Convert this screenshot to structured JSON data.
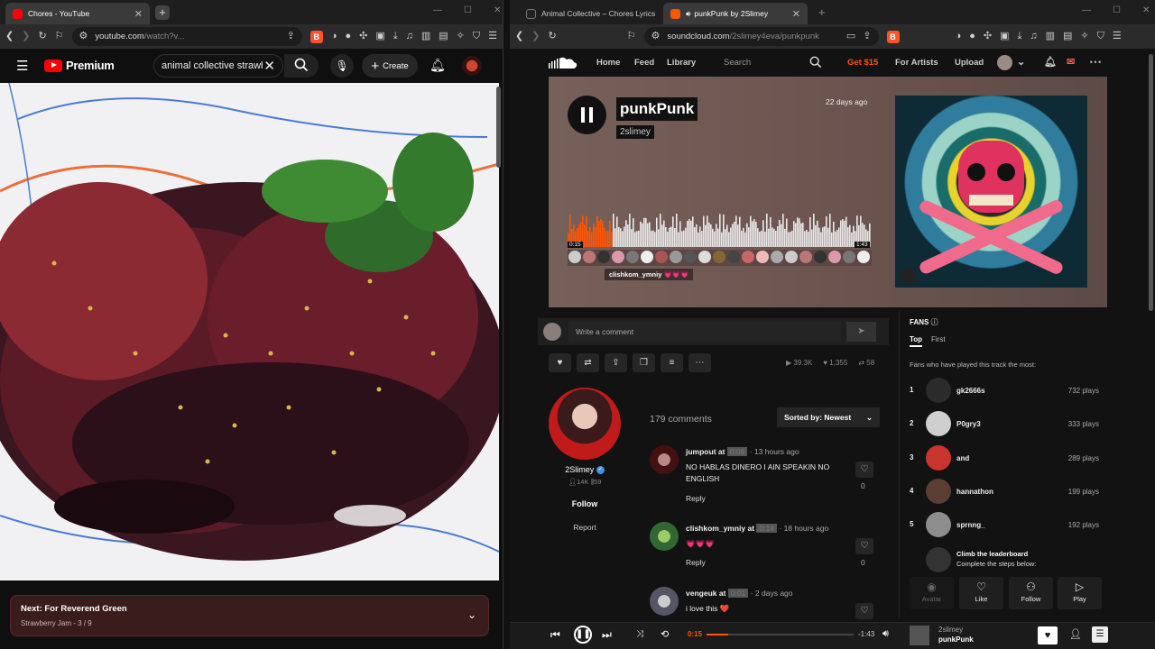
{
  "left_window": {
    "tab": {
      "title": "Chores - YouTube"
    },
    "url": {
      "domain": "youtube.com",
      "path": "/watch?v..."
    },
    "youtube": {
      "logo_text": "Premium",
      "search_value": "animal collective strawb",
      "create_label": "Create",
      "next": {
        "label": "Next: For Reverend Green",
        "playlist": "Strawberry Jam",
        "position": "3 / 9"
      }
    }
  },
  "right_window": {
    "tabs": [
      {
        "title": "Animal Collective – Chores Lyrics | Ge"
      },
      {
        "title": "punkPunk by 2Slimey",
        "active": true
      }
    ],
    "url": {
      "domain": "soundcloud.com",
      "path": "/2slimey4eva/punkpunk"
    },
    "nav": {
      "home": "Home",
      "feed": "Feed",
      "library": "Library",
      "search_placeholder": "Search",
      "get": "Get $15",
      "for_artists": "For Artists",
      "upload": "Upload"
    },
    "track": {
      "title": "punkPunk",
      "artist": "2slimey",
      "age": "22 days ago",
      "time_elapsed": "0:15",
      "time_total": "1:43",
      "progress": 0.146,
      "waveform_comment_user": "clishkom_ymniy",
      "waveform_comment_text": "💗💗💗"
    },
    "comment_input": {
      "placeholder": "Write a comment"
    },
    "stats": {
      "plays": "39.3K",
      "likes": "1,355",
      "reposts": "58"
    },
    "artist": {
      "name": "2Slimey",
      "followers": "14K",
      "tracks": "59",
      "follow": "Follow",
      "report": "Report"
    },
    "comments_header": {
      "count": "179 comments",
      "sort": "Sorted by: Newest"
    },
    "comments": [
      {
        "user": "jumpout",
        "at": "at",
        "timestamp": "0:08",
        "age": "· 13 hours ago",
        "text": "NO HABLAS DINERO I AIN SPEAKIN NO ENGLISH",
        "reply": "Reply",
        "likes": "0"
      },
      {
        "user": "clishkom_ymniy",
        "at": "at",
        "timestamp": "0:14",
        "age": "· 18 hours ago",
        "text": "💗💗💗",
        "reply": "Reply",
        "likes": "0"
      },
      {
        "user": "vengeuk",
        "at": "at",
        "timestamp": "0:01",
        "age": "· 2 days ago",
        "text": "i love this ❤️",
        "reply": "",
        "likes": ""
      }
    ],
    "fans": {
      "title": "FANS",
      "tab_top": "Top",
      "tab_first": "First",
      "subtitle": "Fans who have played this track the most:",
      "list": [
        {
          "rank": "1",
          "name": "gk2666s",
          "plays": "732 plays",
          "color": "#2b2b2b"
        },
        {
          "rank": "2",
          "name": "P0gry3",
          "plays": "333 plays",
          "color": "#cfcfcf"
        },
        {
          "rank": "3",
          "name": "and",
          "plays": "289 plays",
          "color": "#c9342c"
        },
        {
          "rank": "4",
          "name": "hannathon",
          "plays": "199 plays",
          "color": "#5a3e32"
        },
        {
          "rank": "5",
          "name": "sprnng_",
          "plays": "192 plays",
          "color": "#8d8d8d"
        }
      ],
      "climb_title": "Climb the leaderboard",
      "climb_sub": "Complete the steps below:",
      "steps": [
        "Avatar",
        "Like",
        "Follow",
        "Play"
      ]
    },
    "player": {
      "elapsed": "0:15",
      "total": "-1:43",
      "artist": "2slimey",
      "title": "punkPunk",
      "progress": 0.146
    }
  },
  "colors": {
    "soundcloud_orange": "#ff5500",
    "youtube_red": "#ff0000",
    "next_bg": "#3b1c1c"
  }
}
